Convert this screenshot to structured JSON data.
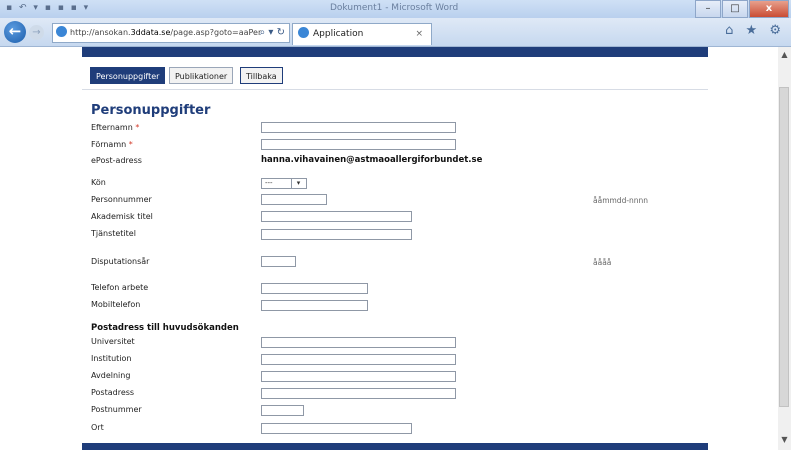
{
  "window": {
    "title": "Dokument1 - Microsoft Word",
    "controls": [
      "–",
      "□",
      "x"
    ]
  },
  "browser": {
    "address": {
      "prefix": "http://ansokan.",
      "host": "3ddata.se",
      "path": "/page.asp?goto=aaPer",
      "icons": "⌕ ▾ ↻"
    },
    "tab": {
      "label": "Application",
      "close": "×"
    },
    "right_icons": "⌂ ★ ⚙",
    "back_icon": "←",
    "forward_icon": "→"
  },
  "nav": {
    "personuppgifter": "Personuppgifter",
    "publikationer": "Publikationer",
    "tillbaka": "Tillbaka"
  },
  "form": {
    "title": "Personuppgifter",
    "required_mark": "*",
    "efternamn": "Efternamn",
    "fornamn": "Förnamn",
    "epost_label": "ePost-adress",
    "epost_value": "hanna.vihavainen@astmaoallergiforbundet.se",
    "kon": "Kön",
    "kon_value": "---",
    "kon_arrow": "▾",
    "personnummer": "Personnummer",
    "personnummer_hint": "ååmmdd-nnnn",
    "akademisk_titel": "Akademisk titel",
    "tjanstetitel": "Tjänstetitel",
    "disputationsar": "Disputationsår",
    "disputationsar_hint": "åååå",
    "telefon_arbete": "Telefon arbete",
    "mobiltelefon": "Mobiltelefon",
    "postadress_heading": "Postadress till huvudsökanden",
    "universitet": "Universitet",
    "institution": "Institution",
    "avdelning": "Avdelning",
    "postadress": "Postadress",
    "postnummer": "Postnummer",
    "ort": "Ort"
  },
  "scrollbar": {
    "up": "▲",
    "down": "▼"
  }
}
